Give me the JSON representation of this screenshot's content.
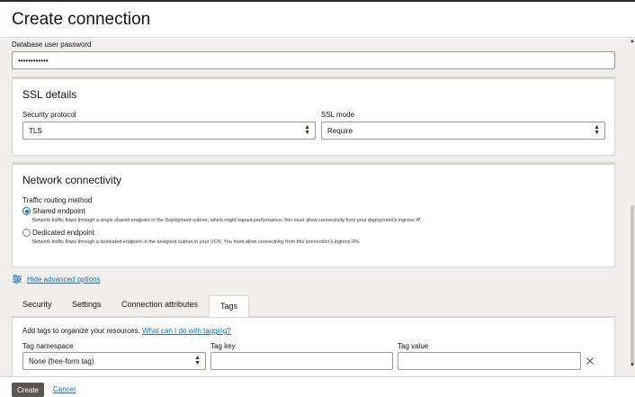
{
  "header": {
    "title": "Create connection"
  },
  "password": {
    "label": "Database user password",
    "value": "••••••••••••"
  },
  "ssl": {
    "title": "SSL details",
    "protocol_label": "Security protocol",
    "protocol_value": "TLS",
    "mode_label": "SSL mode",
    "mode_value": "Require"
  },
  "network": {
    "title": "Network connectivity",
    "routing_label": "Traffic routing method",
    "options": [
      {
        "label": "Shared endpoint",
        "selected": true,
        "help": "Network traffic flows through a single shared endpoint in the Deployment subnet, which might impact performance. You must allow connectivity from your deployment's ingress IP."
      },
      {
        "label": "Dedicated endpoint",
        "selected": false,
        "help": "Network traffic flows through a dedicated endpoint in the assigned subnet in your VCN. You must allow connectivity from this connection's ingress IPs."
      }
    ]
  },
  "advanced": {
    "label": "Hide advanced options",
    "icon": "sliders-icon"
  },
  "tabs": [
    {
      "label": "Security",
      "active": false
    },
    {
      "label": "Settings",
      "active": false
    },
    {
      "label": "Connection attributes",
      "active": false
    },
    {
      "label": "Tags",
      "active": true
    }
  ],
  "tags": {
    "intro": "Add tags to organize your resources.",
    "help_link": "What can I do with tagging?",
    "namespace_label": "Tag namespace",
    "namespace_value": "None (free-form tag)",
    "key_label": "Tag key",
    "key_value": "",
    "value_label": "Tag value",
    "value_value": "",
    "remove_icon": "close-icon"
  },
  "footer": {
    "create": "Create",
    "cancel": "Cancel"
  },
  "colors": {
    "accent": "#1e6fa7",
    "primary_button": "#5b5652",
    "page_bg": "#f1efed"
  }
}
